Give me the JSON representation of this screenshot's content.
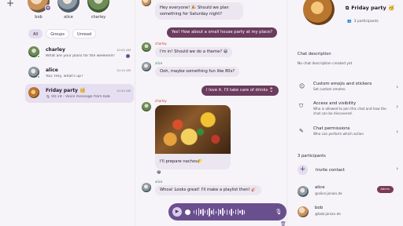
{
  "sidebar": {
    "stories": [
      {
        "name": "bob"
      },
      {
        "name": "alice"
      },
      {
        "name": "charley"
      }
    ],
    "filters": [
      {
        "label": "All",
        "active": true
      },
      {
        "label": "Groups",
        "active": false
      },
      {
        "label": "Unread",
        "active": false
      }
    ],
    "chats": [
      {
        "name": "charley",
        "message": "What are your plans for the weekend?",
        "time": "10:02 AM",
        "unread": true
      },
      {
        "name": "alice",
        "message": "You: Hey, what's up?",
        "time": "10:15 AM",
        "unread": false
      },
      {
        "name": "Friday party 🥳",
        "message": "🎙 00:19 - Voice message from bob",
        "time": "10:25 AM",
        "unread": false
      }
    ]
  },
  "conversation": {
    "messages": [
      {
        "text": "Hey everyone! 🎉 Should we plan something for Saturday night?"
      },
      {
        "text": "Yes! How about a small house party at my place?"
      },
      {
        "sender": "charley",
        "text": "I'm in! Should we do a theme? 😄"
      },
      {
        "sender": "alice",
        "text": "Ooh, maybe something fun like 80s?"
      },
      {
        "text": "I love it. I'll take care of drinks 🍷"
      },
      {
        "sender": "charley",
        "caption": "I'll prepare nachos🌮",
        "reaction": "😂"
      },
      {
        "sender": "alice",
        "text": "Whoa! Looks great! I'll make a playlist then! 🎸"
      }
    ],
    "composer": {
      "mode": "voice"
    }
  },
  "details": {
    "title": "Friday party 🥳",
    "participants_count": "3 participants",
    "description_heading": "Chat description",
    "description_text": "No chat description created yet",
    "options": [
      {
        "title": "Custom emojis and stickers",
        "desc": "Set custom emotes"
      },
      {
        "title": "Access and visibility",
        "desc": "Who is allowed to join this chat and how the chat can be discovered."
      },
      {
        "title": "Chat permissions",
        "desc": "Who can perform which action"
      }
    ],
    "participants_heading": "3 participants",
    "invite_label": "Invite contact",
    "participants": [
      {
        "name": "alice",
        "id": "@alice:janian.de",
        "badge": "Admin"
      },
      {
        "name": "bob",
        "id": "@bob:janian.de",
        "badge": ""
      }
    ]
  }
}
